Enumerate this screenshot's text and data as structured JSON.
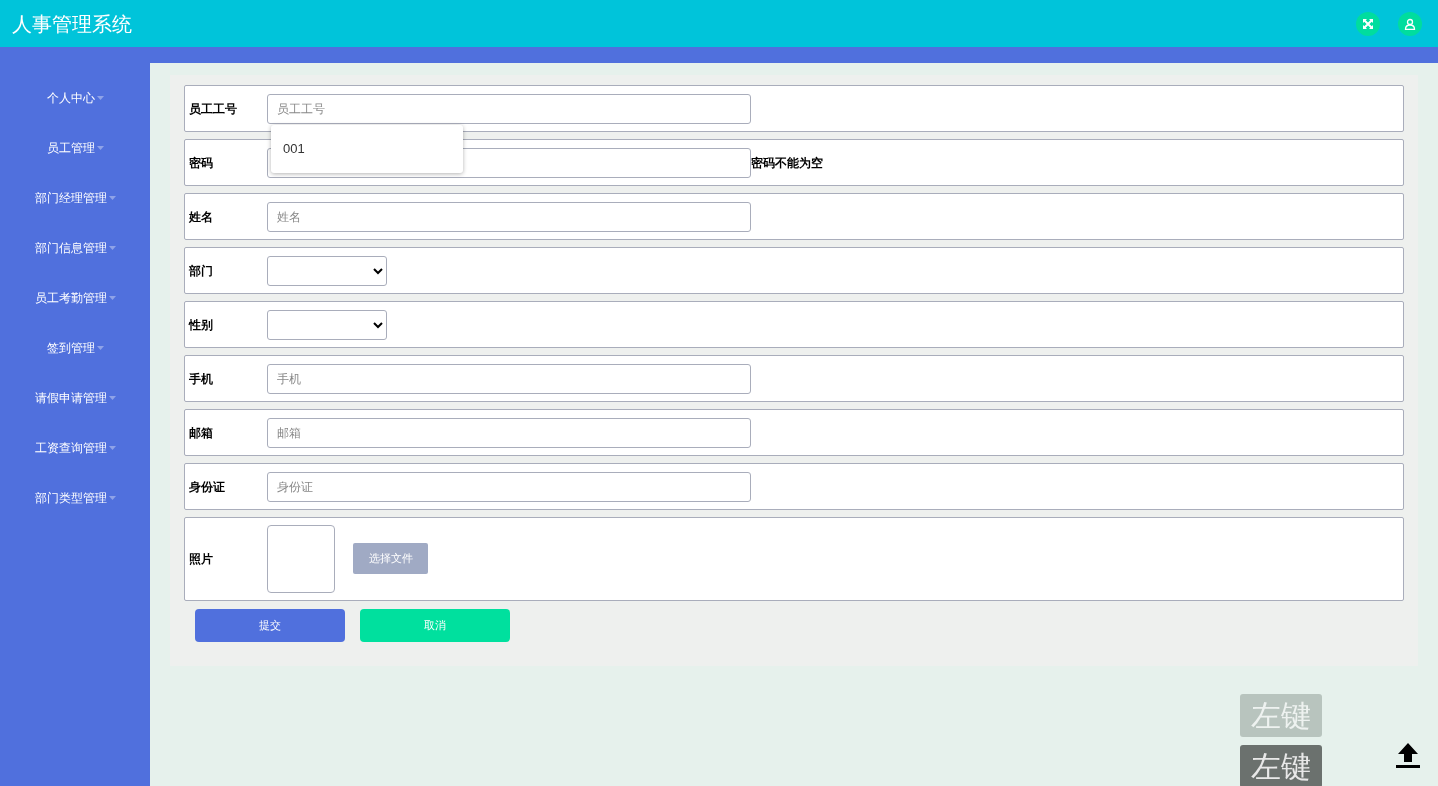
{
  "header": {
    "title": "人事管理系统"
  },
  "sidebar": {
    "items": [
      {
        "label": "个人中心"
      },
      {
        "label": "员工管理"
      },
      {
        "label": "部门经理管理"
      },
      {
        "label": "部门信息管理"
      },
      {
        "label": "员工考勤管理"
      },
      {
        "label": "签到管理"
      },
      {
        "label": "请假申请管理"
      },
      {
        "label": "工资查询管理"
      },
      {
        "label": "部门类型管理"
      }
    ]
  },
  "form": {
    "fields": [
      {
        "kind": "text",
        "label": "员工工号",
        "placeholder": "员工工号",
        "suggestions": [
          "001"
        ]
      },
      {
        "kind": "text",
        "label": "密码",
        "error": "密码不能为空"
      },
      {
        "kind": "text",
        "label": "姓名",
        "placeholder": "姓名"
      },
      {
        "kind": "select",
        "label": "部门"
      },
      {
        "kind": "select",
        "label": "性别"
      },
      {
        "kind": "text",
        "label": "手机",
        "placeholder": "手机"
      },
      {
        "kind": "text",
        "label": "邮箱",
        "placeholder": "邮箱"
      },
      {
        "kind": "text",
        "label": "身份证",
        "placeholder": "身份证"
      },
      {
        "kind": "photo",
        "label": "照片",
        "button": "选择文件"
      }
    ],
    "buttons": [
      {
        "kind": "primary",
        "label": "提交"
      },
      {
        "kind": "secondary",
        "label": "取消"
      }
    ]
  },
  "key_indicators": [
    {
      "label": "左键",
      "faded": true
    },
    {
      "label": "左键",
      "faded": false
    }
  ]
}
